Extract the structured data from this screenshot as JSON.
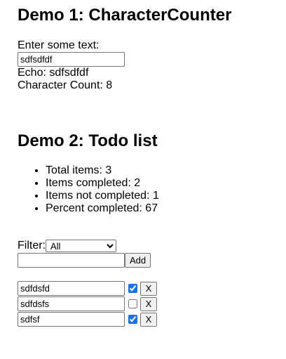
{
  "demo1": {
    "heading": "Demo 1: CharacterCounter",
    "prompt": "Enter some text:",
    "input_value": "sdfsdfdf",
    "echo_label": "Echo: ",
    "echo_value": "sdfsdfdf",
    "count_label": "Character Count: ",
    "count_value": "8"
  },
  "demo2": {
    "heading": "Demo 2: Todo list",
    "stats": [
      {
        "label": "Total items: ",
        "value": "3"
      },
      {
        "label": "Items completed: ",
        "value": "2"
      },
      {
        "label": "Items not completed: ",
        "value": "1"
      },
      {
        "label": "Percent completed: ",
        "value": "67"
      }
    ],
    "filter_label": "Filter:",
    "filter_selected": "All",
    "new_item_value": "",
    "add_label": "Add",
    "todos": [
      {
        "text": "sdfdsfd",
        "completed": true,
        "delete_label": "X"
      },
      {
        "text": "sdfdsfs",
        "completed": false,
        "delete_label": "X"
      },
      {
        "text": "sdfsf",
        "completed": true,
        "delete_label": "X"
      }
    ]
  }
}
